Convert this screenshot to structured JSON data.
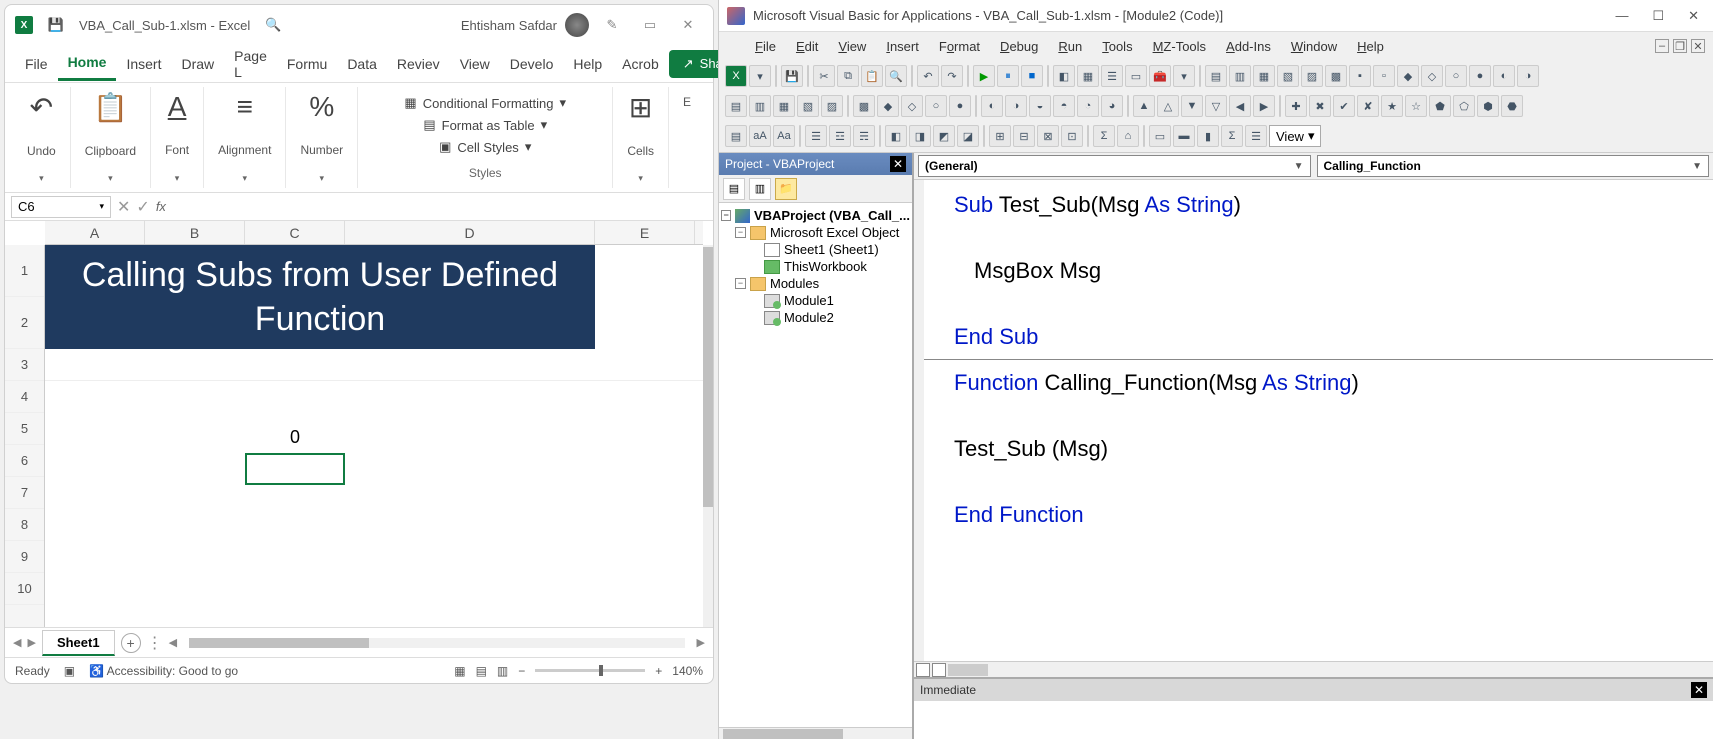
{
  "excel": {
    "titlebar": {
      "filename": "VBA_Call_Sub-1.xlsm - Excel",
      "user": "Ehtisham Safdar"
    },
    "ribbon_tabs": {
      "file": "File",
      "home": "Home",
      "insert": "Insert",
      "draw": "Draw",
      "page": "Page L",
      "formu": "Formu",
      "data": "Data",
      "review": "Reviev",
      "view": "View",
      "devel": "Develo",
      "help": "Help",
      "acrob": "Acrob"
    },
    "share": "Share",
    "groups": {
      "undo": "Undo",
      "clipboard": "Clipboard",
      "font": "Font",
      "alignment": "Alignment",
      "number": "Number",
      "styles_label": "Styles",
      "cf": "Conditional Formatting",
      "fat": "Format as Table",
      "cs": "Cell Styles",
      "cells": "Cells",
      "editing": "E"
    },
    "namebox": "C6",
    "formula": "",
    "columns": [
      "A",
      "B",
      "C",
      "D",
      "E"
    ],
    "rows": [
      "1",
      "2",
      "3",
      "4",
      "5",
      "6",
      "7",
      "8",
      "9",
      "10"
    ],
    "merged_header": "Calling Subs from User Defined Function",
    "c5_value": "0",
    "sheet_tab": "Sheet1",
    "status": {
      "ready": "Ready",
      "access": "Accessibility: Good to go",
      "zoom": "140%"
    }
  },
  "vba": {
    "title": "Microsoft Visual Basic for Applications - VBA_Call_Sub-1.xlsm - [Module2 (Code)]",
    "menus": {
      "file": "File",
      "edit": "Edit",
      "view": "View",
      "insert": "Insert",
      "format": "Format",
      "debug": "Debug",
      "run": "Run",
      "tools": "Tools",
      "mztools": "MZ-Tools",
      "addins": "Add-Ins",
      "window": "Window",
      "help": "Help"
    },
    "view_dd": "View",
    "project_title": "Project - VBAProject",
    "tree": {
      "root": "VBAProject (VBA_Call_...",
      "excel_objects": "Microsoft Excel Object",
      "sheet1": "Sheet1 (Sheet1)",
      "thisworkbook": "ThisWorkbook",
      "modules": "Modules",
      "module1": "Module1",
      "module2": "Module2"
    },
    "code_dd_left": "(General)",
    "code_dd_right": "Calling_Function",
    "code": {
      "l1a": "Sub",
      "l1b": " Test_Sub(Msg ",
      "l1c": "As String",
      "l1d": ")",
      "l2": " MsgBox Msg",
      "l3": "End Sub",
      "l4a": "Function",
      "l4b": " Calling_Function(Msg ",
      "l4c": "As String",
      "l4d": ")",
      "l5": " Test_Sub (Msg)",
      "l6": "End Function"
    },
    "immediate": "Immediate"
  }
}
